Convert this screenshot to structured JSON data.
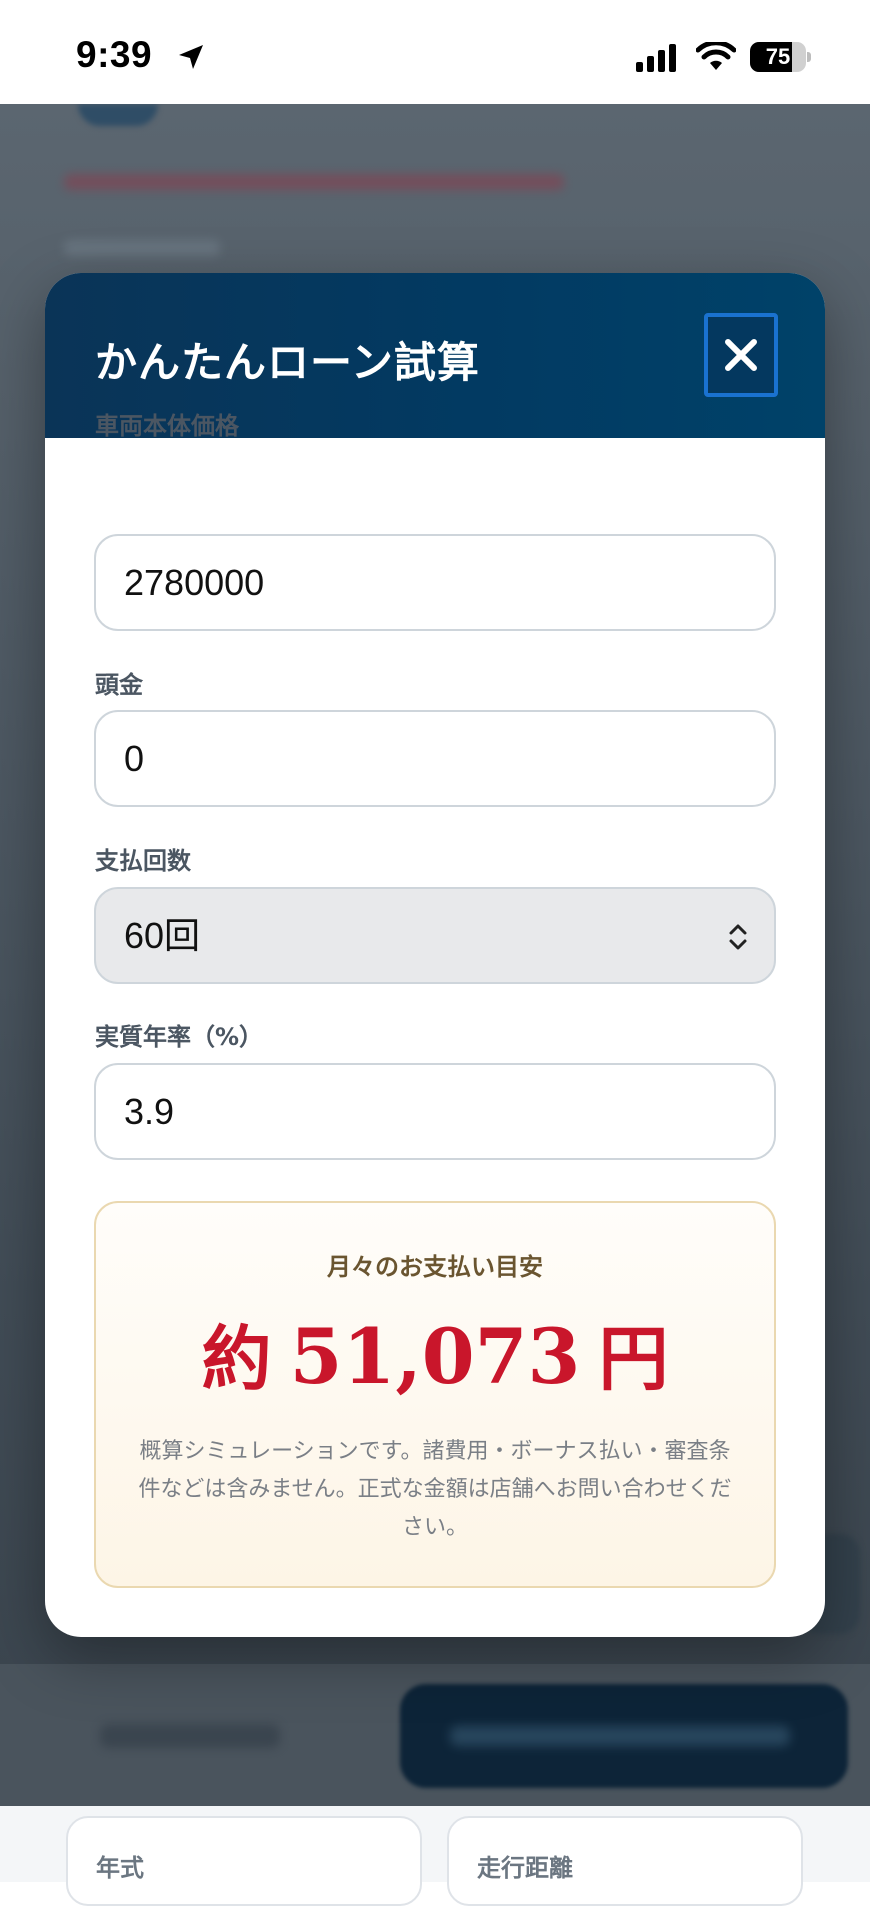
{
  "status_bar": {
    "time": "9:39",
    "battery_level": "75",
    "battery_fraction": 0.75
  },
  "background_page": {
    "spec_labels": [
      "年式",
      "走行距離"
    ]
  },
  "modal": {
    "title": "かんたんローン試算",
    "close_icon": "close-icon",
    "fields": {
      "vehicle_price": {
        "label": "車両本体価格",
        "value": "2780000"
      },
      "down_payment": {
        "label": "頭金",
        "value": "0"
      },
      "installments": {
        "label": "支払回数",
        "value": "60回"
      },
      "annual_rate": {
        "label": "実質年率（%）",
        "value": "3.9"
      }
    },
    "result": {
      "label": "月々のお支払い目安",
      "prefix": "約",
      "amount": "51,073",
      "unit": "円",
      "note": "概算シミュレーションです。諸費用・ボーナス払い・審査条件などは含みません。正式な金額は店舗へお問い合わせください。"
    }
  },
  "colors": {
    "header": "#023a62",
    "amount": "#c9162b",
    "close_border": "#1a72d0"
  }
}
